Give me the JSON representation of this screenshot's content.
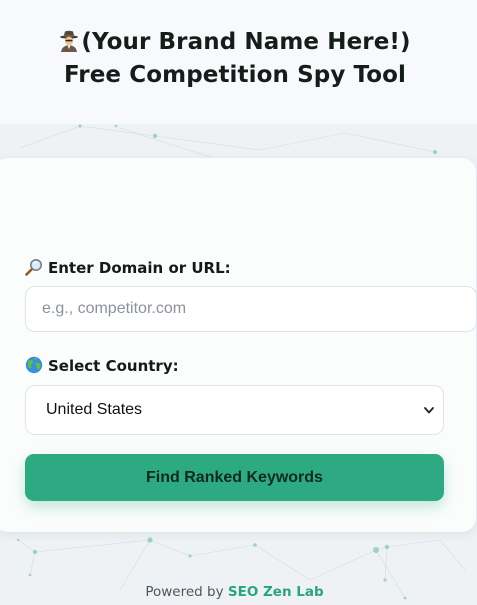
{
  "header": {
    "title_line1": "(Your Brand Name Here!)",
    "title_line2": "Free Competition Spy Tool",
    "title_icon": "spy-detective-icon"
  },
  "form": {
    "domain_label": "Enter Domain or URL:",
    "domain_label_icon": "magnifier-icon",
    "domain_placeholder": "e.g., competitor.com",
    "domain_value": "",
    "country_label": "Select Country:",
    "country_label_icon": "globe-icon",
    "country_selected": "United States",
    "submit_label": "Find Ranked Keywords"
  },
  "footer": {
    "prefix": "Powered by",
    "brand": "SEO Zen Lab"
  },
  "colors": {
    "accent": "#2eaa82",
    "footer_brand": "#2aa57b",
    "page_bg": "#eef2f5",
    "header_bg": "#f7f9fc"
  }
}
